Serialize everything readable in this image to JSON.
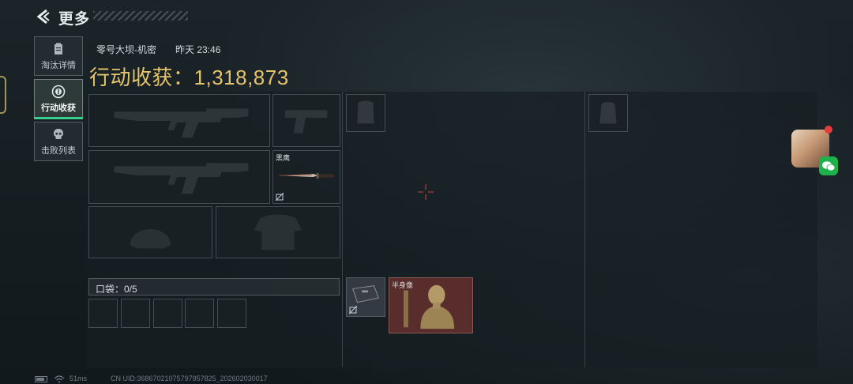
{
  "header": {
    "title": "更多"
  },
  "tabs": [
    {
      "label": "淘汰详情",
      "icon": "clipboard-icon"
    },
    {
      "label": "行动收获",
      "icon": "coin-icon"
    },
    {
      "label": "击败列表",
      "icon": "skull-icon"
    }
  ],
  "match": {
    "map": "零号大坝-机密",
    "time": "昨天 23:46",
    "haul_label": "行动收获：",
    "haul_value": "1,318,873"
  },
  "items": {
    "knife_name": "黑鹰",
    "bust_name": "半身像"
  },
  "pocket": {
    "label": "口袋：0/5"
  },
  "status": {
    "ping": "51ms",
    "uid": "CN UID:36867021075797957825_202602030017"
  },
  "colors": {
    "accent_green": "#38d08d",
    "gold": "#e5c36a",
    "bust_bg": "#5a2d2d",
    "wechat": "#1fb24c"
  }
}
